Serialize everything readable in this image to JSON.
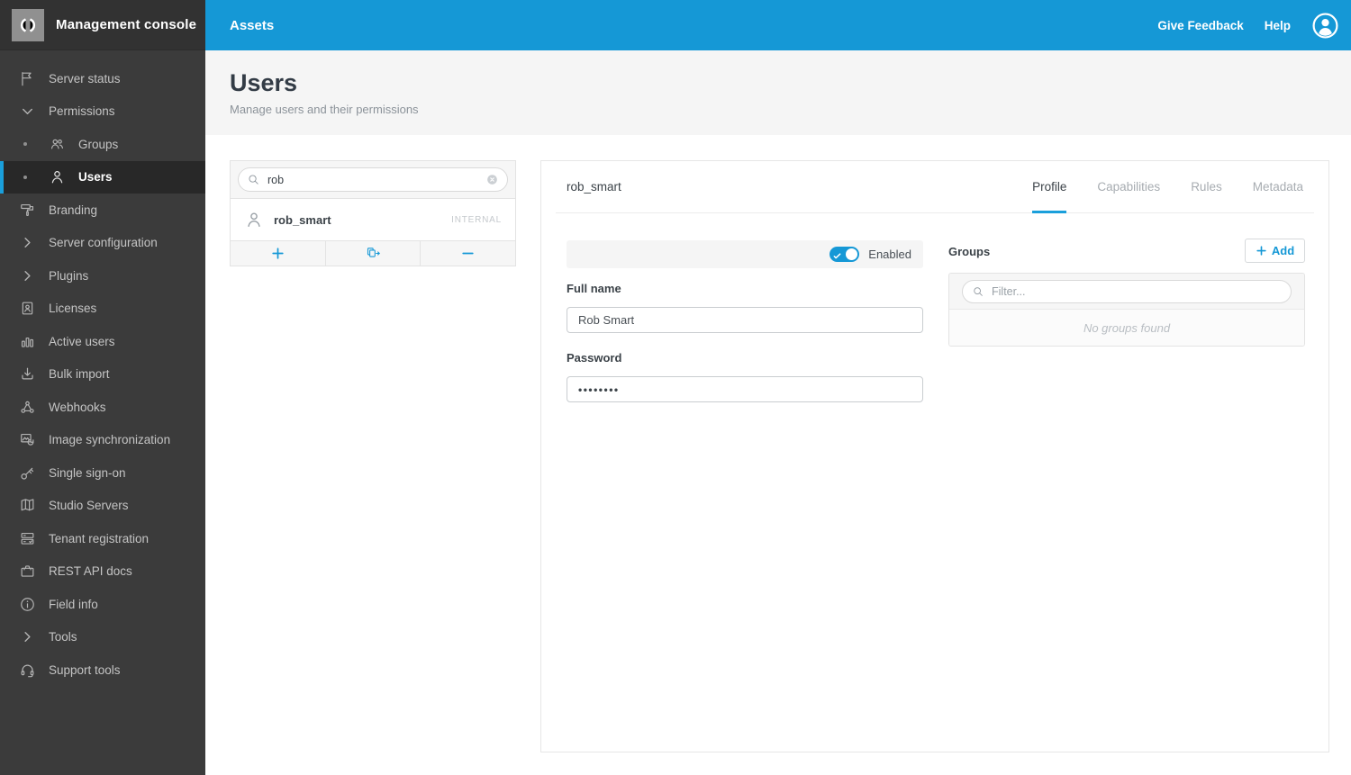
{
  "sidebar": {
    "title": "Management console",
    "logo_icon": "open-text-logo-icon",
    "items": [
      {
        "label": "Server status",
        "icon": "flag-icon"
      },
      {
        "label": "Permissions",
        "icon": "chevron-down-icon"
      },
      {
        "label": "Groups",
        "icon": "groups-icon",
        "sub": true
      },
      {
        "label": "Users",
        "icon": "user-icon",
        "sub": true,
        "selected": true
      },
      {
        "label": "Branding",
        "icon": "paint-roller-icon"
      },
      {
        "label": "Server configuration",
        "icon": "chevron-right-icon"
      },
      {
        "label": "Plugins",
        "icon": "chevron-right-icon"
      },
      {
        "label": "Licenses",
        "icon": "id-badge-icon"
      },
      {
        "label": "Active users",
        "icon": "bar-chart-icon"
      },
      {
        "label": "Bulk import",
        "icon": "download-icon"
      },
      {
        "label": "Webhooks",
        "icon": "webhook-icon"
      },
      {
        "label": "Image synchronization",
        "icon": "image-sync-icon"
      },
      {
        "label": "Single sign-on",
        "icon": "key-icon"
      },
      {
        "label": "Studio Servers",
        "icon": "map-icon"
      },
      {
        "label": "Tenant registration",
        "icon": "server-check-icon"
      },
      {
        "label": "REST API docs",
        "icon": "toolbox-icon"
      },
      {
        "label": "Field info",
        "icon": "info-icon"
      },
      {
        "label": "Tools",
        "icon": "chevron-right-icon"
      },
      {
        "label": "Support tools",
        "icon": "headset-icon"
      }
    ]
  },
  "topbar": {
    "app_title": "Assets",
    "feedback_label": "Give Feedback",
    "help_label": "Help"
  },
  "page_header": {
    "title": "Users",
    "subtitle": "Manage users and their permissions"
  },
  "user_list": {
    "search_value": "rob",
    "items": [
      {
        "username": "rob_smart",
        "badge": "INTERNAL"
      }
    ],
    "toolbar": [
      {
        "name": "add-user",
        "icon": "plus-icon"
      },
      {
        "name": "copy-user-to",
        "icon": "copy-arrow-icon"
      },
      {
        "name": "remove-user",
        "icon": "minus-icon"
      }
    ]
  },
  "detail": {
    "username": "rob_smart",
    "tabs": [
      {
        "label": "Profile",
        "active": true
      },
      {
        "label": "Capabilities"
      },
      {
        "label": "Rules"
      },
      {
        "label": "Metadata"
      }
    ],
    "enabled_label": "Enabled",
    "enabled_state": true,
    "full_name_label": "Full name",
    "full_name_value": "Rob Smart",
    "password_label": "Password",
    "password_value": "••••••••",
    "groups": {
      "label": "Groups",
      "add_label": "Add",
      "filter_placeholder": "Filter...",
      "empty_text": "No groups found"
    }
  },
  "colors": {
    "accent_blue": "#1598d6",
    "sidebar_bg": "#3b3b3b",
    "sidebar_selected_bg": "#282828",
    "header_band_bg": "#f5f5f5",
    "panel_border": "#e3e3e3",
    "text_dark": "#3b4248",
    "text_muted": "#8b9299"
  }
}
